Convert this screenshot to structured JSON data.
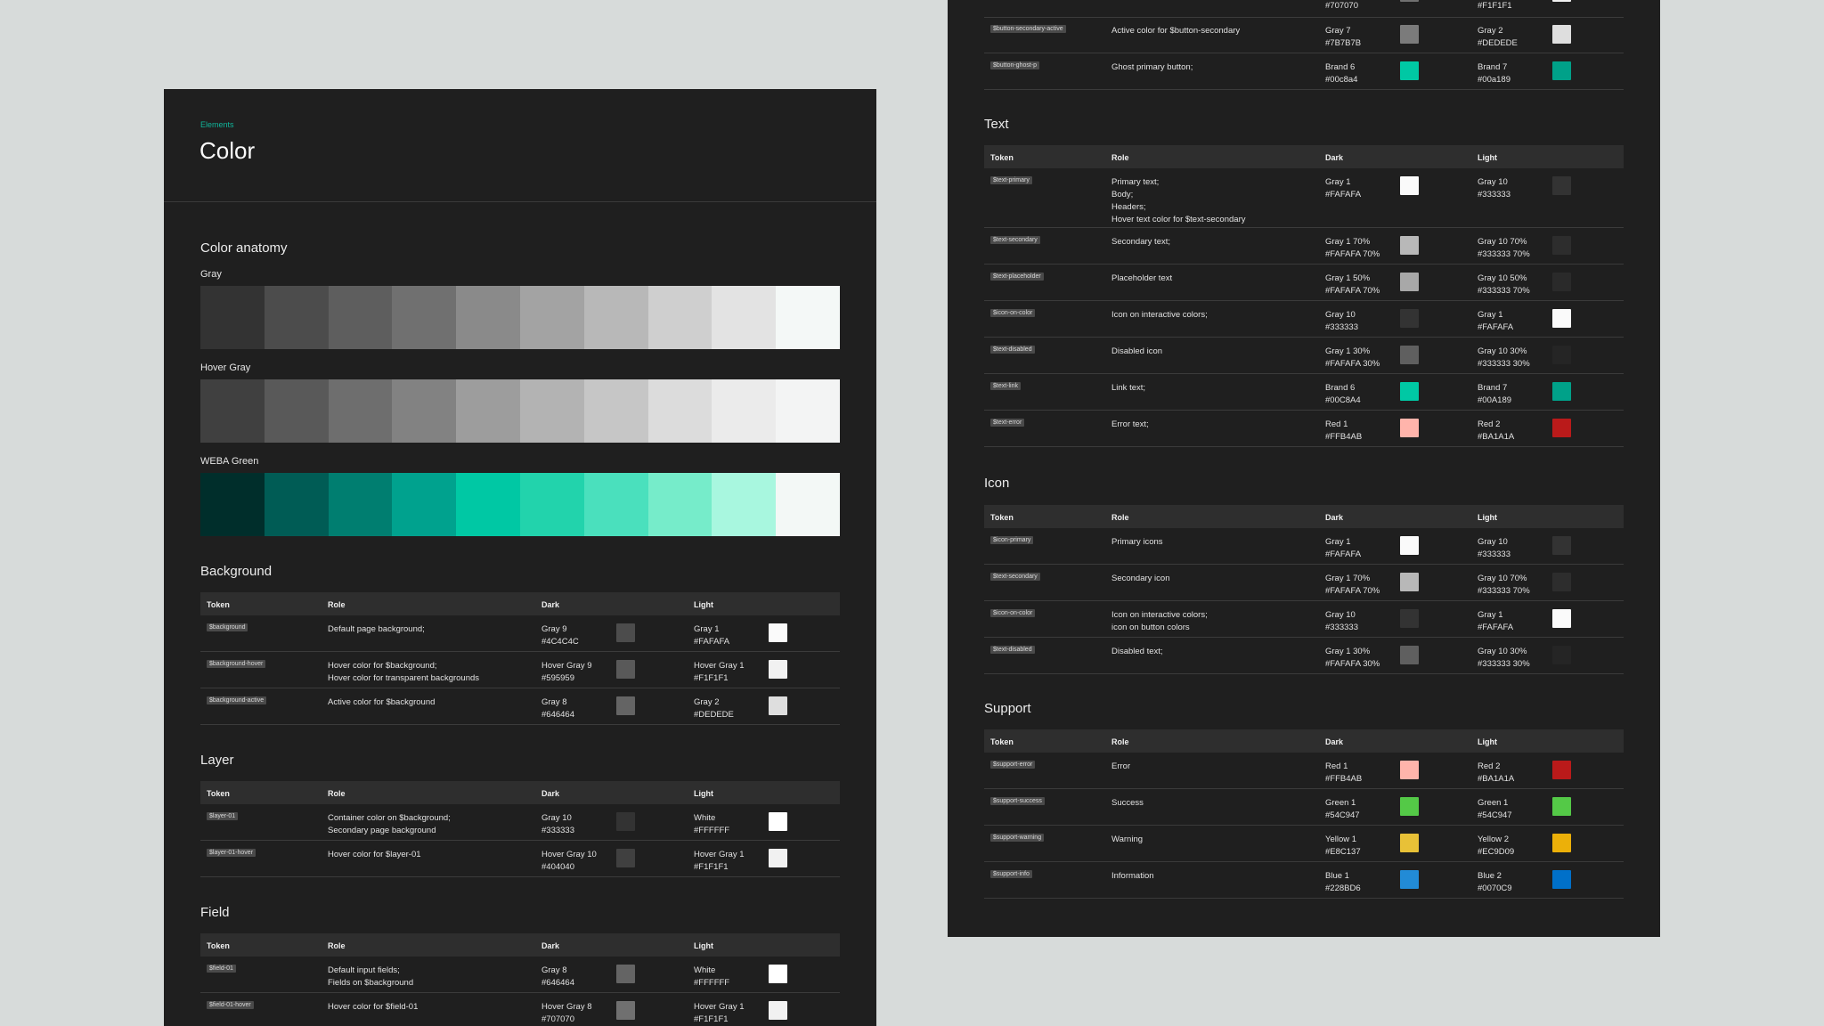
{
  "left": {
    "breadcrumb": "Elements",
    "title": "Color",
    "anatomy_title": "Color anatomy",
    "strips": [
      {
        "label": "Gray",
        "colors": [
          "#333333",
          "#4c4c4c",
          "#5e5e5e",
          "#707070",
          "#8a8a8a",
          "#a3a3a3",
          "#b8b8b8",
          "#cfcfcf",
          "#e3e3e3",
          "#f4f8f7"
        ]
      },
      {
        "label": "Hover Gray",
        "colors": [
          "#404040",
          "#595959",
          "#6e6e6e",
          "#828282",
          "#9d9d9d",
          "#b3b3b3",
          "#c6c6c6",
          "#dcdcdc",
          "#ebebeb",
          "#f3f4f4"
        ]
      },
      {
        "label": "WEBA Green",
        "colors": [
          "#002e2b",
          "#005c55",
          "#007e70",
          "#00a28e",
          "#00c8a4",
          "#22d3ac",
          "#4ae0bd",
          "#76ecca",
          "#a8f7df",
          "#f3f8f6"
        ]
      }
    ],
    "headers": {
      "token": "Token",
      "role": "Role",
      "dark": "Dark",
      "light": "Light"
    },
    "background": {
      "title": "Background",
      "rows": [
        {
          "token": "$background",
          "role": "Default page background;",
          "dark": "Gray 9\n#4C4C4C",
          "dark_color": "#4c4c4c",
          "light": "Gray 1\n#FAFAFA",
          "light_color": "#fafafa"
        },
        {
          "token": "$background-hover",
          "role": "Hover color for $background;\nHover color for transparent backgrounds",
          "dark": "Hover Gray 9\n#595959",
          "dark_color": "#595959",
          "light": "Hover Gray 1\n#F1F1F1",
          "light_color": "#f1f1f1"
        },
        {
          "token": "$background-active",
          "role": "Active color for $background",
          "dark": "Gray 8\n#646464",
          "dark_color": "#646464",
          "light": "Gray 2\n#DEDEDE",
          "light_color": "#dedede"
        }
      ]
    },
    "layer": {
      "title": "Layer",
      "rows": [
        {
          "token": "$layer-01",
          "role": "Container color on $background;\nSecondary page background",
          "dark": "Gray 10\n#333333",
          "dark_color": "#333333",
          "light": "White\n#FFFFFF",
          "light_color": "#ffffff"
        },
        {
          "token": "$layer-01-hover",
          "role": "Hover color for $layer-01",
          "dark": "Hover Gray 10\n#404040",
          "dark_color": "#404040",
          "light": "Hover Gray 1\n#F1F1F1",
          "light_color": "#f1f1f1"
        }
      ]
    },
    "field": {
      "title": "Field",
      "rows": [
        {
          "token": "$field-01",
          "role": "Default input fields;\nFields on $background",
          "dark": "Gray 8\n#646464",
          "dark_color": "#646464",
          "light": "White\n#FFFFFF",
          "light_color": "#ffffff"
        },
        {
          "token": "$field-01-hover",
          "role": "Hover color for $field-01",
          "dark": "Hover Gray 8\n#707070",
          "dark_color": "#707070",
          "light": "Hover Gray 1\n#F1F1F1",
          "light_color": "#f1f1f1"
        }
      ]
    }
  },
  "right": {
    "headers": {
      "token": "Token",
      "role": "Role",
      "dark": "Dark",
      "light": "Light"
    },
    "button_partial": {
      "top_dark": "#707070",
      "top_light": "#F1F1F1",
      "rows": [
        {
          "token": "$button-secondary-active",
          "role": "Active color for $button-secondary",
          "dark": "Gray 7\n#7B7B7B",
          "dark_color": "#7b7b7b",
          "light": "Gray 2\n#DEDEDE",
          "light_color": "#dedede"
        },
        {
          "token": "$button-ghost-p",
          "role": "Ghost primary button;",
          "dark": "Brand 6\n#00c8a4",
          "dark_color": "#00c8a4",
          "light": "Brand 7\n#00a189",
          "light_color": "#00a189"
        }
      ]
    },
    "text": {
      "title": "Text",
      "rows": [
        {
          "token": "$text-primary",
          "role": "Primary text;\nBody;\nHeaders;\nHover text color for $text-secondary",
          "dark": "Gray 1\n#FAFAFA",
          "dark_color": "#fafafa",
          "light": "Gray 10\n#333333",
          "light_color": "#333333"
        },
        {
          "token": "$text-secondary",
          "role": "Secondary text;",
          "dark": "Gray 1 70%\n#FAFAFA 70%",
          "dark_color": "#b8b8b8",
          "light": "Gray 10 70%\n#333333 70%",
          "light_color": "#2d2d2d"
        },
        {
          "token": "$text-placeholder",
          "role": "Placeholder text",
          "dark": "Gray 1 50%\n#FAFAFA 70%",
          "dark_color": "#a8a8a8",
          "light": "Gray 10 50%\n#333333 70%",
          "light_color": "#2a2a2a"
        },
        {
          "token": "$icon-on-color",
          "role": "Icon on interactive colors;",
          "dark": "Gray 10\n#333333",
          "dark_color": "#333333",
          "light": "Gray 1\n#FAFAFA",
          "light_color": "#fafafa"
        },
        {
          "token": "$text-disabled",
          "role": "Disabled icon",
          "dark": "Gray 1 30%\n#FAFAFA 30%",
          "dark_color": "#5f5f5f",
          "light": "Gray 10 30%\n#333333 30%",
          "light_color": "#252525"
        },
        {
          "token": "$text-link",
          "role": "Link text;",
          "dark": "Brand 6\n#00C8A4",
          "dark_color": "#00c8a4",
          "light": "Brand 7\n#00A189",
          "light_color": "#00a189"
        },
        {
          "token": "$text-error",
          "role": "Error text;",
          "dark": "Red 1\n#FFB4AB",
          "dark_color": "#ffb4ab",
          "light": "Red 2\n#BA1A1A",
          "light_color": "#ba1a1a"
        }
      ]
    },
    "icon": {
      "title": "Icon",
      "rows": [
        {
          "token": "$icon-primary",
          "role": "Primary icons",
          "dark": "Gray 1\n#FAFAFA",
          "dark_color": "#fafafa",
          "light": "Gray 10\n#333333",
          "light_color": "#333333"
        },
        {
          "token": "$text-secondary",
          "role": "Secondary icon",
          "dark": "Gray 1 70%\n#FAFAFA 70%",
          "dark_color": "#b8b8b8",
          "light": "Gray 10 70%\n#333333 70%",
          "light_color": "#2d2d2d"
        },
        {
          "token": "$icon-on-color",
          "role": "Icon on interactive colors;\nicon on button colors",
          "dark": "Gray 10\n#333333",
          "dark_color": "#333333",
          "light": "Gray 1\n#FAFAFA",
          "light_color": "#fafafa"
        },
        {
          "token": "$text-disabled",
          "role": "Disabled text;",
          "dark": "Gray 1 30%\n#FAFAFA 30%",
          "dark_color": "#5f5f5f",
          "light": "Gray 10 30%\n#333333 30%",
          "light_color": "#252525"
        }
      ]
    },
    "support": {
      "title": "Support",
      "rows": [
        {
          "token": "$support-error",
          "role": "Error",
          "dark": "Red 1\n#FFB4AB",
          "dark_color": "#ffb4ab",
          "light": "Red 2\n#BA1A1A",
          "light_color": "#ba1a1a"
        },
        {
          "token": "$support-success",
          "role": "Success",
          "dark": "Green 1\n#54C947",
          "dark_color": "#54c947",
          "light": "Green 1\n#54C947",
          "light_color": "#54c947"
        },
        {
          "token": "$support-warning",
          "role": "Warning",
          "dark": "Yellow 1\n#E8C137",
          "dark_color": "#e8c137",
          "light": "Yellow 2\n#EC9D09",
          "light_color": "#ecb009"
        },
        {
          "token": "$support-info",
          "role": "Information",
          "dark": "Blue 1\n#228BD6",
          "dark_color": "#228bd6",
          "light": "Blue 2\n#0070C9",
          "light_color": "#0070c9"
        }
      ]
    }
  }
}
